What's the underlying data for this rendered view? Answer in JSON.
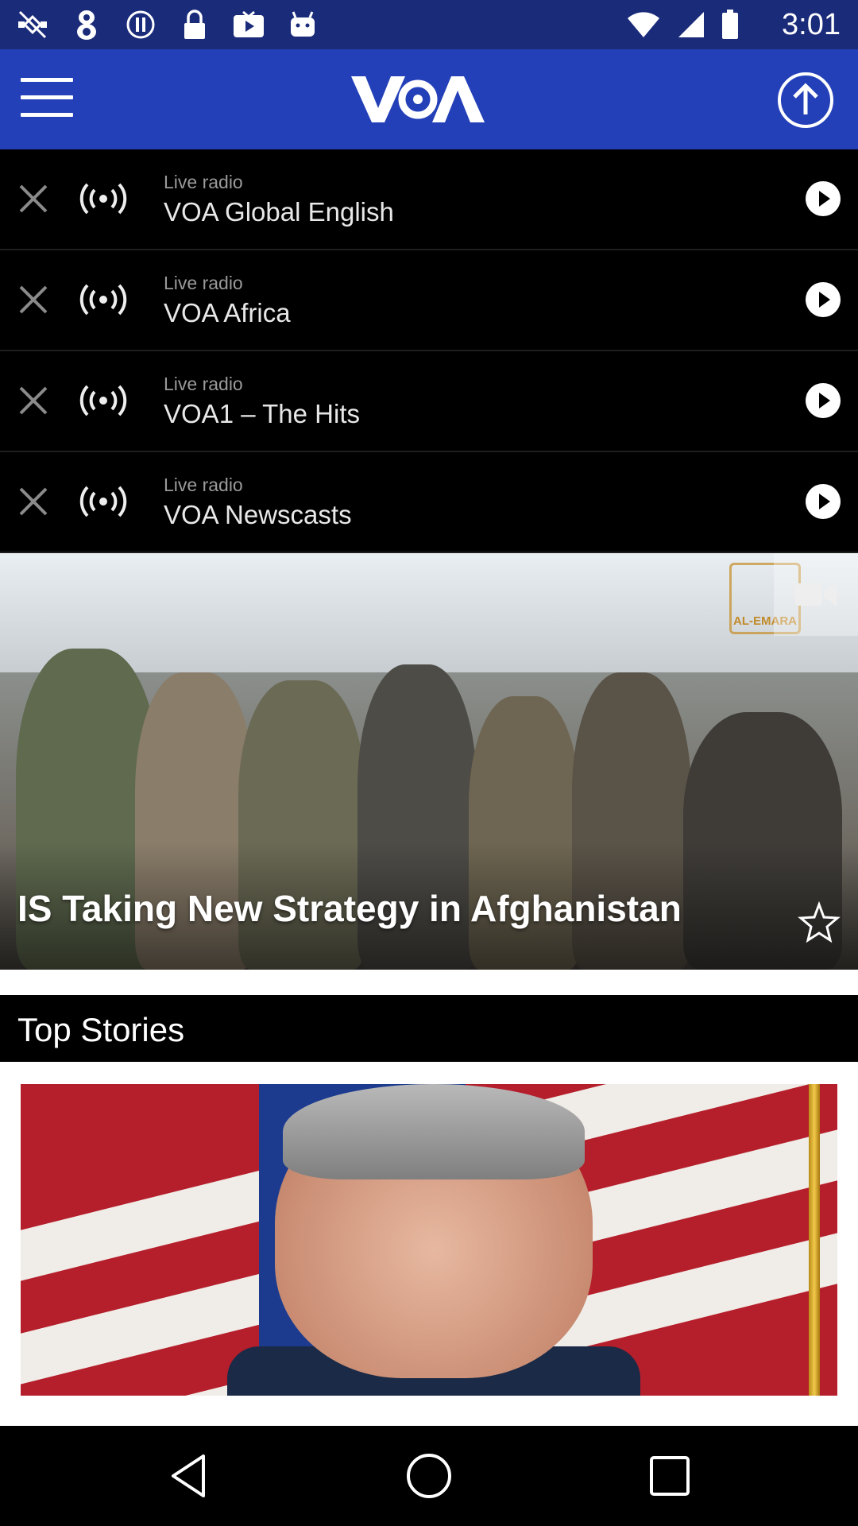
{
  "status_bar": {
    "time": "3:01",
    "left_icons": [
      "satellite-off-icon",
      "digit-eight-icon",
      "info-circle-icon",
      "lock-icon",
      "youtube-icon",
      "android-icon"
    ]
  },
  "header": {
    "logo_text": "VOA",
    "menu_icon": "hamburger-menu-icon",
    "up_icon": "arrow-up-circle-icon",
    "background": "#2340b8"
  },
  "radio": {
    "items": [
      {
        "kicker": "Live radio",
        "title": "VOA Global English"
      },
      {
        "kicker": "Live radio",
        "title": "VOA Africa"
      },
      {
        "kicker": "Live radio",
        "title": "VOA1 – The Hits"
      },
      {
        "kicker": "Live radio",
        "title": "VOA Newscasts"
      }
    ]
  },
  "hero": {
    "headline": "IS Taking New Strategy in Afghanistan",
    "watermark_text": "AL-EMARA",
    "video_icon": "video-camera-icon",
    "favorite_icon": "star-outline-icon"
  },
  "section": {
    "title": "Top Stories"
  },
  "nav": {
    "back_icon": "back-triangle-icon",
    "home_icon": "home-circle-icon",
    "recents_icon": "recents-square-icon"
  }
}
